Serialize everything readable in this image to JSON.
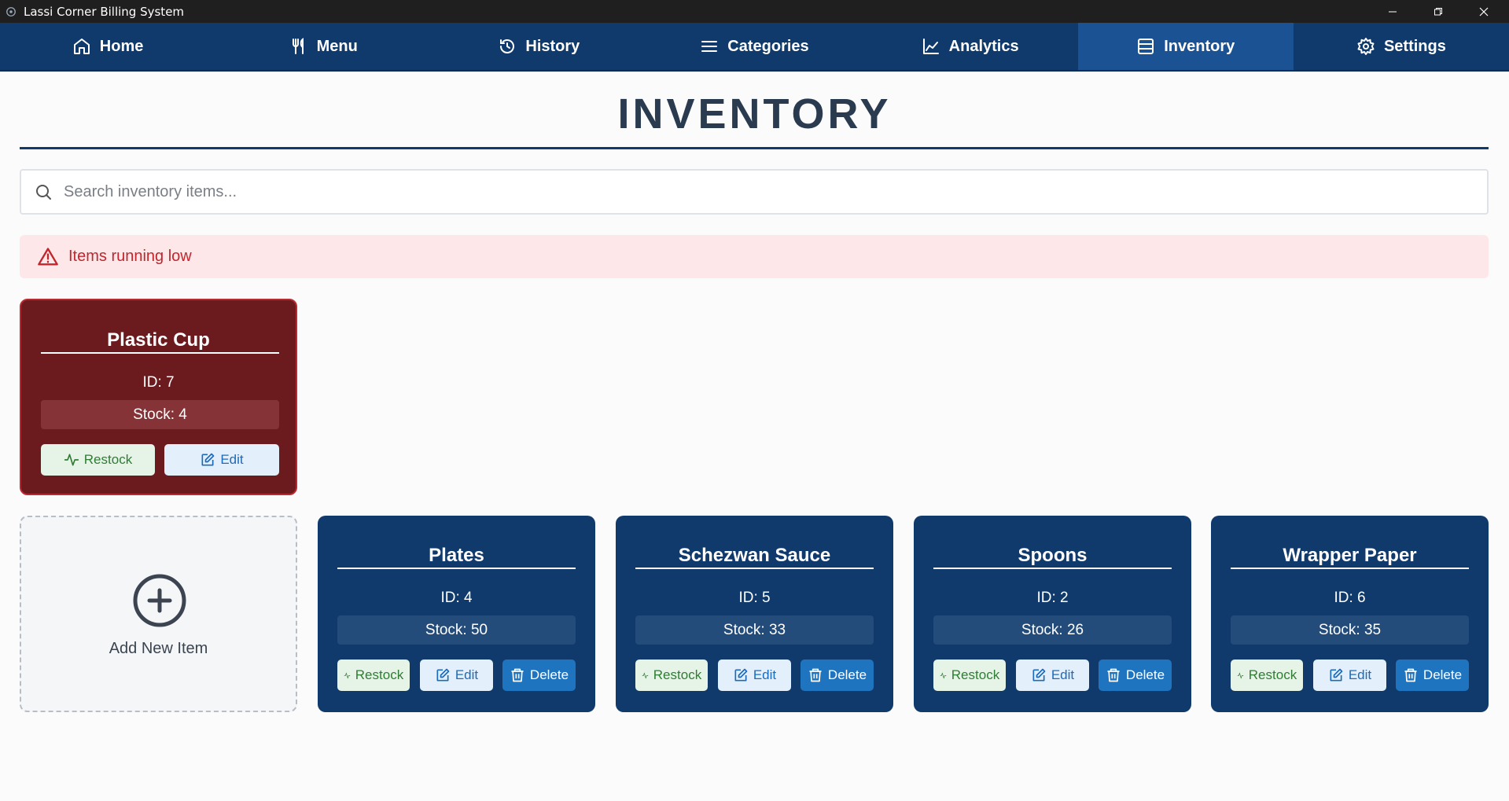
{
  "window": {
    "title": "Lassi Corner Billing System",
    "controls": [
      "minimize-icon",
      "restore-icon",
      "close-icon"
    ]
  },
  "nav": [
    {
      "label": "Home",
      "icon": "home-icon"
    },
    {
      "label": "Menu",
      "icon": "fork-knife-icon"
    },
    {
      "label": "History",
      "icon": "history-icon"
    },
    {
      "label": "Categories",
      "icon": "list-icon"
    },
    {
      "label": "Analytics",
      "icon": "chart-icon"
    },
    {
      "label": "Inventory",
      "icon": "inventory-icon",
      "active": true
    },
    {
      "label": "Settings",
      "icon": "gear-icon"
    }
  ],
  "page": {
    "title": "INVENTORY",
    "search_placeholder": "Search inventory items...",
    "alert_text": "Items running low",
    "add_label": "Add New Item"
  },
  "colors": {
    "nav_bg": "#0f3a6b",
    "nav_active": "#1a5294",
    "card_bg": "#0f3a6b",
    "low_card_bg": "#6b1a1d",
    "alert_bg": "#fde7e9",
    "alert_text": "#c0272d"
  },
  "low_stock": [
    {
      "name": "Plastic Cup",
      "id": "ID: 7",
      "stock": "Stock: 4",
      "restock": "Restock",
      "edit": "Edit"
    }
  ],
  "items": [
    {
      "name": "Plates",
      "id": "ID: 4",
      "stock": "Stock: 50",
      "restock": "Restock",
      "edit": "Edit",
      "delete": "Delete"
    },
    {
      "name": "Schezwan Sauce",
      "id": "ID: 5",
      "stock": "Stock: 33",
      "restock": "Restock",
      "edit": "Edit",
      "delete": "Delete"
    },
    {
      "name": "Spoons",
      "id": "ID: 2",
      "stock": "Stock: 26",
      "restock": "Restock",
      "edit": "Edit",
      "delete": "Delete"
    },
    {
      "name": "Wrapper Paper",
      "id": "ID: 6",
      "stock": "Stock: 35",
      "restock": "Restock",
      "edit": "Edit",
      "delete": "Delete"
    }
  ]
}
